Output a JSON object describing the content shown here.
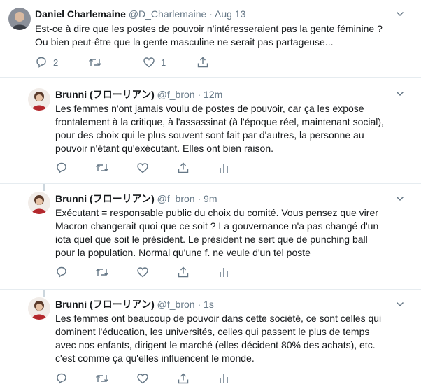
{
  "tweets": [
    {
      "name": "Daniel Charlemaine",
      "handle": "@D_Charlemaine",
      "time": "Aug 13",
      "lines": [
        "Est-ce à dire que les postes de pouvoir n'intéresseraient pas la gente féminine ?",
        "Ou bien peut-être que la gente masculine ne serait pas partageuse..."
      ],
      "reply_count": "2",
      "retweet_count": "",
      "like_count": "1"
    },
    {
      "name": "Brunni (フローリアン)",
      "handle": "@f_bron",
      "time": "12m",
      "lines": [
        "Les femmes n'ont jamais voulu de postes de pouvoir, car ça les expose",
        "frontalement à la critique, à l'assassinat (à l'époque réel, maintenant social),",
        "pour des choix qui le plus souvent sont fait par d'autres, la personne au",
        "pouvoir n'étant qu'exécutant. Elles ont bien raison."
      ]
    },
    {
      "name": "Brunni (フローリアン)",
      "handle": "@f_bron",
      "time": "9m",
      "lines": [
        "Exécutant = responsable public du choix du comité. Vous pensez que virer",
        "Macron changerait quoi que ce soit ? La gouvernance n'a pas changé d'un",
        "iota quel que soit le président. Le président ne sert que de punching ball",
        "pour la population. Normal qu'une f. ne veule d'un tel poste"
      ]
    },
    {
      "name": "Brunni (フローリアン)",
      "handle": "@f_bron",
      "time": "1s",
      "lines": [
        "Les femmes ont beaucoup de pouvoir dans cette société, ce sont celles qui",
        "dominent l'éducation, les universités, celles qui passent le plus de temps",
        "avec nos enfants, dirigent le marché (elles décident 80% des achats), etc.",
        "c'est comme ça qu'elles influencent le monde."
      ]
    }
  ],
  "separator": "·",
  "colors": {
    "text": "#14171a",
    "muted": "#657786",
    "thread_line": "#ccd6dd",
    "divider": "#e6ecf0"
  },
  "icons": [
    "chevron-down-icon",
    "reply-icon",
    "retweet-icon",
    "like-icon",
    "share-icon",
    "analytics-icon"
  ]
}
